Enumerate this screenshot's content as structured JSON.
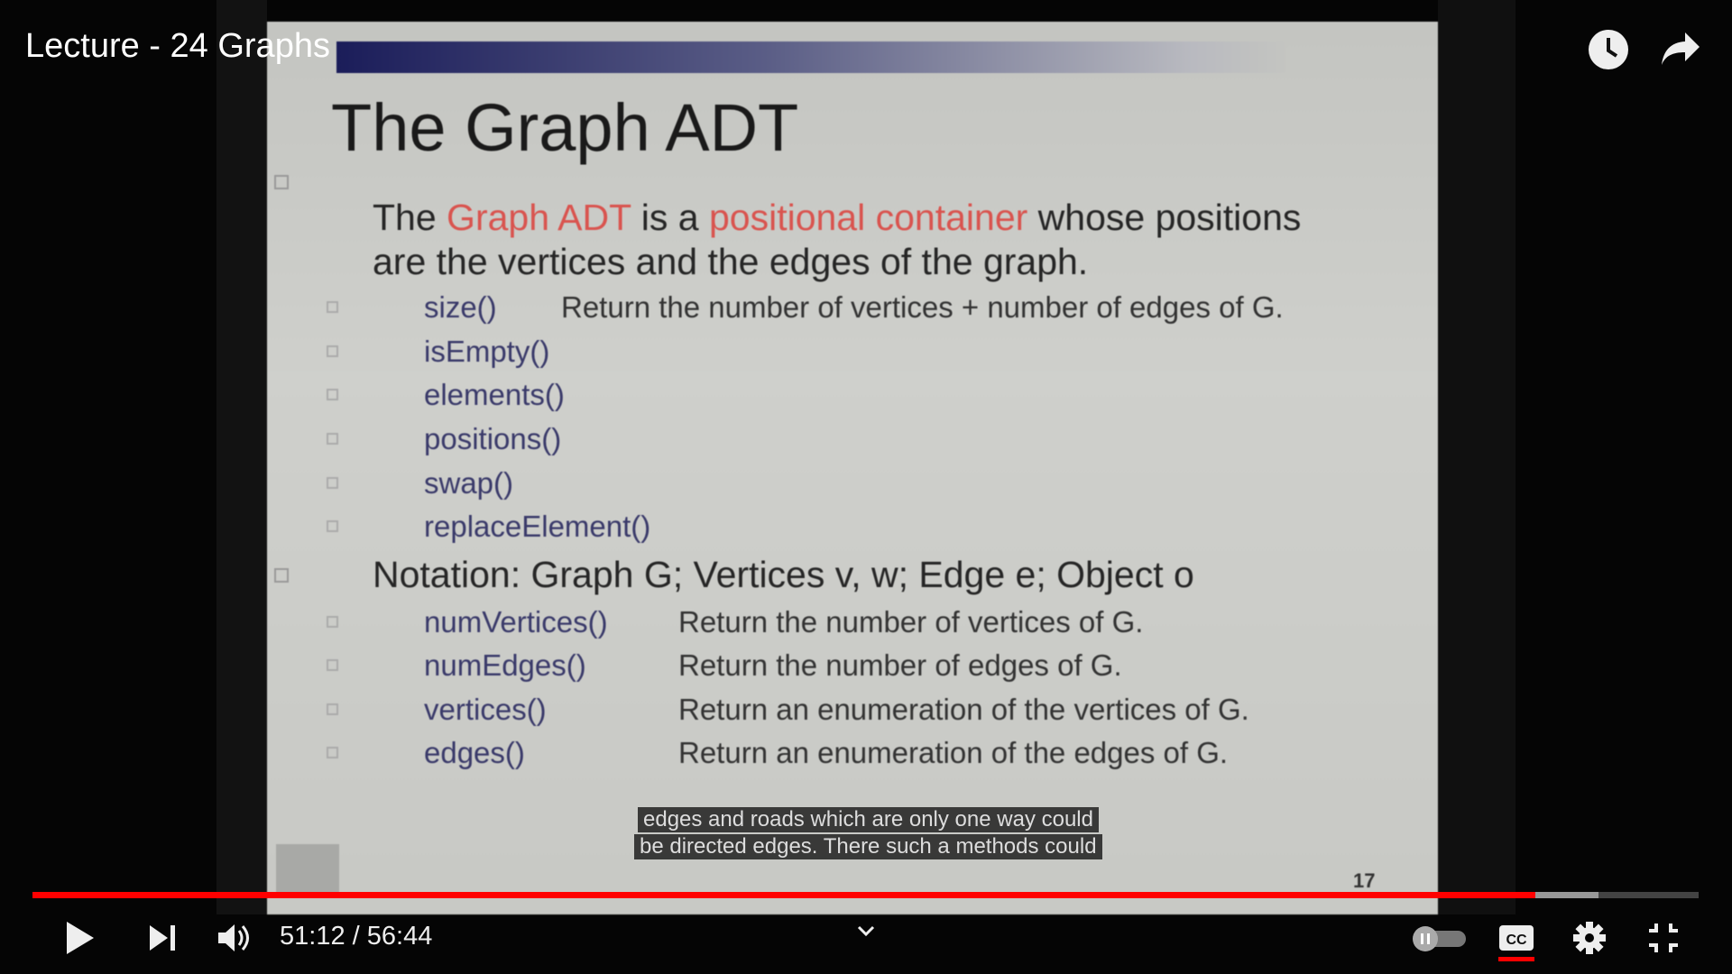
{
  "video": {
    "title": "Lecture - 24 Graphs",
    "progress_percent": 90.2,
    "buffered_percent": 94.0,
    "current_time": "51:12",
    "duration": "56:44",
    "time_separator": " / ",
    "colors": {
      "progress": "#ff0000"
    }
  },
  "slide": {
    "title": "The Graph ADT",
    "bullet1": {
      "pre": "The ",
      "hl1": "Graph ADT",
      "mid": " is a ",
      "hl2": "positional container",
      "post": " whose positions",
      "line2": "are the vertices and the edges of the graph."
    },
    "methods1": [
      {
        "name": "size()",
        "desc": "Return the number of vertices + number of edges of G."
      },
      {
        "name": "isEmpty()",
        "desc": ""
      },
      {
        "name": "elements()",
        "desc": ""
      },
      {
        "name": "positions()",
        "desc": ""
      },
      {
        "name": "swap()",
        "desc": ""
      },
      {
        "name": "replaceElement()",
        "desc": ""
      }
    ],
    "bullet2": "Notation: Graph G; Vertices v, w; Edge e; Object o",
    "methods2": [
      {
        "name": "numVertices()",
        "desc": "Return the number of vertices of G."
      },
      {
        "name": "numEdges()",
        "desc": "Return the number of edges of G."
      },
      {
        "name": "vertices()",
        "desc": "Return an enumeration of the vertices of G."
      },
      {
        "name": "edges()",
        "desc": "Return an enumeration of the edges of G."
      }
    ],
    "page_number": "17"
  },
  "captions": [
    "edges and roads which are only one way could",
    "be directed edges. There such a methods could"
  ],
  "icons": [
    "clock-icon",
    "share-icon",
    "play-icon",
    "next-icon",
    "volume-icon",
    "chevron-down-icon",
    "autoplay-toggle",
    "cc-icon",
    "gear-icon",
    "exit-fullscreen-icon"
  ]
}
